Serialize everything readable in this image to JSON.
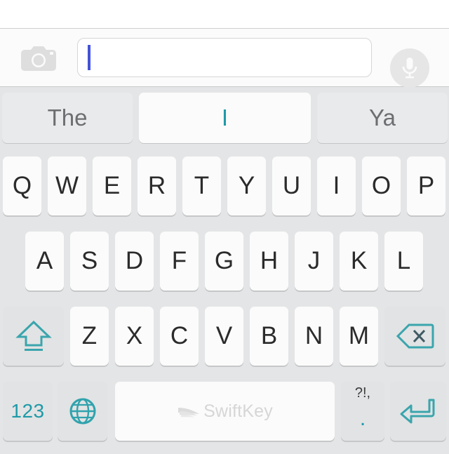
{
  "app": {
    "name": "SwiftKey Keyboard",
    "brand_label": "SwiftKey"
  },
  "input_bar": {
    "camera_icon": "camera-icon",
    "mic_icon": "microphone-icon",
    "text_value": "",
    "placeholder": "",
    "caret_color": "#4353d8"
  },
  "suggestions": {
    "items": [
      {
        "label": "The",
        "active": false
      },
      {
        "label": "I",
        "active": true
      },
      {
        "label": "Ya",
        "active": false
      }
    ]
  },
  "keyboard": {
    "row1": [
      "Q",
      "W",
      "E",
      "R",
      "T",
      "Y",
      "U",
      "I",
      "O",
      "P"
    ],
    "row2": [
      "A",
      "S",
      "D",
      "F",
      "G",
      "H",
      "J",
      "K",
      "L"
    ],
    "row3": [
      "Z",
      "X",
      "C",
      "V",
      "B",
      "N",
      "M"
    ],
    "shift_icon": "shift-arrow-icon",
    "backspace_icon": "backspace-icon",
    "numbers_label": "123",
    "globe_icon": "globe-icon",
    "space_label": "SwiftKey",
    "punctuation_secondary": "?!,",
    "punctuation_primary": ".",
    "enter_icon": "enter-return-icon"
  },
  "colors": {
    "accent_teal": "#1f9aa8",
    "keyboard_bg": "#e4e5e6",
    "key_bg": "#fbfbfb",
    "key_gray_bg": "#e2e3e4",
    "text_dark": "#2b2b2b",
    "text_gray": "#6d6e71"
  }
}
